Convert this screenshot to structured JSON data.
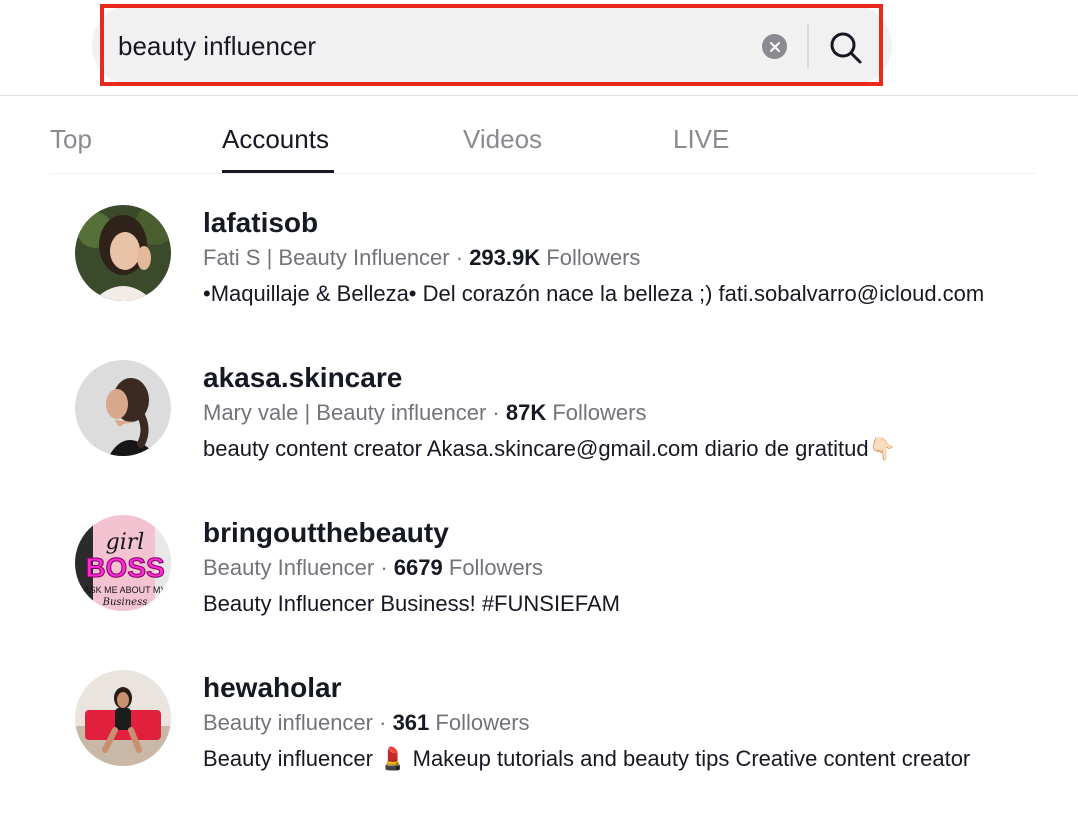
{
  "search": {
    "query": "beauty influencer",
    "clear_icon": "close-icon",
    "search_icon": "search-icon",
    "highlight_color": "#e8291b"
  },
  "tabs": [
    {
      "label": "Top",
      "active": false
    },
    {
      "label": "Accounts",
      "active": true
    },
    {
      "label": "Videos",
      "active": false
    },
    {
      "label": "LIVE",
      "active": false
    }
  ],
  "accounts": [
    {
      "username": "lafatisob",
      "display_name": "Fati S | Beauty Influencer",
      "followers_count": "293.9K",
      "followers_label": "Followers",
      "bio": "•Maquillaje & Belleza• Del corazón nace la belleza ;) fati.sobalvarro@icloud.com"
    },
    {
      "username": "akasa.skincare",
      "display_name": "Mary vale | Beauty influencer",
      "followers_count": "87K",
      "followers_label": "Followers",
      "bio": "beauty content creator Akasa.skincare@gmail.com diario de gratitud👇🏻"
    },
    {
      "username": "bringoutthebeauty",
      "display_name": "Beauty Influencer",
      "followers_count": "6679",
      "followers_label": "Followers",
      "bio": "Beauty Influencer Business! #FUNSIEFAM",
      "avatar_text": {
        "line1": "girl",
        "line2": "BOSS",
        "line3": "ASK ME ABOUT MY",
        "line4": "Business"
      }
    },
    {
      "username": "hewaholar",
      "display_name": "Beauty influencer",
      "followers_count": "361",
      "followers_label": "Followers",
      "bio": "Beauty influencer 💄 Makeup tutorials and beauty tips Creative content creator"
    }
  ],
  "separator": " · "
}
